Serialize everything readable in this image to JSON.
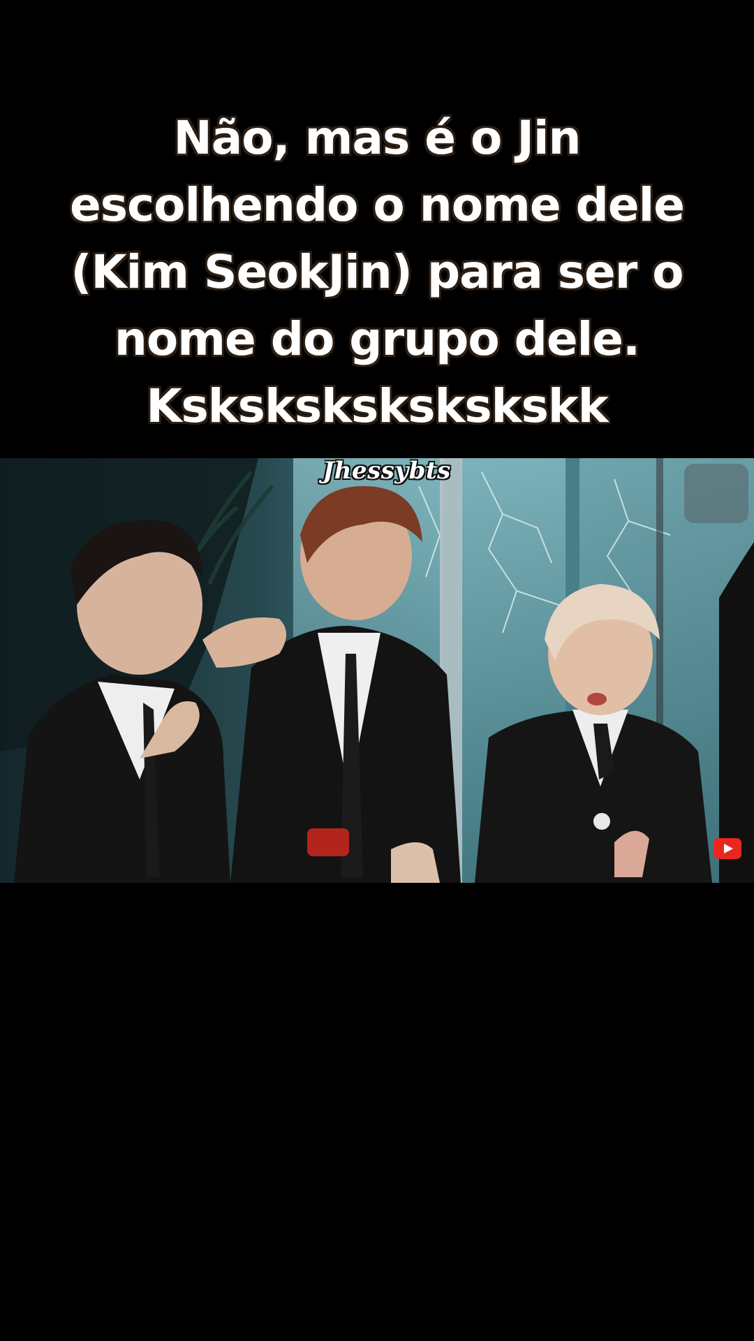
{
  "caption": {
    "lines": [
      "Não, mas é o Jin",
      "escolhendo o nome dele",
      "(Kim SeokJin) para ser o",
      "nome do grupo dele.",
      "Kskskskskskskskk"
    ]
  },
  "watermark": {
    "text": "Jhessybts"
  },
  "colors": {
    "background": "#000000",
    "caption_text": "#ffffff",
    "caption_outline": "#2a1e14",
    "badge": "#e8281f"
  },
  "icons": {
    "corner_badge": "play-icon"
  }
}
